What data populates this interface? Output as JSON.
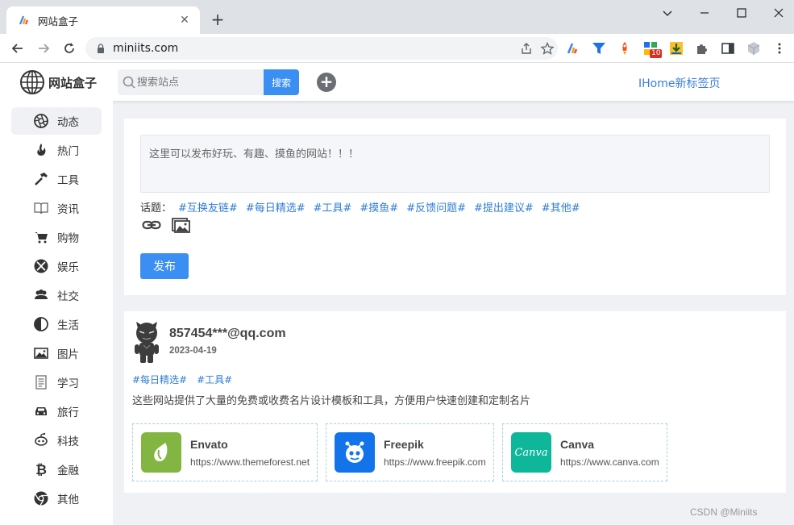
{
  "browser": {
    "tab_title": "网站盒子",
    "url": "miniits.com",
    "extension_badge": "10"
  },
  "site": {
    "logo_text": "网站盒子",
    "search_placeholder": "搜索站点",
    "search_button": "搜索",
    "add_button": "+",
    "ihome_link": "IHome新标签页"
  },
  "sidebar": {
    "items": [
      {
        "label": "动态",
        "icon": "aperture-icon"
      },
      {
        "label": "热门",
        "icon": "fire-icon"
      },
      {
        "label": "工具",
        "icon": "hammer-icon"
      },
      {
        "label": "资讯",
        "icon": "book-icon"
      },
      {
        "label": "购物",
        "icon": "cart-icon"
      },
      {
        "label": "娱乐",
        "icon": "xbox-icon"
      },
      {
        "label": "社交",
        "icon": "users-icon"
      },
      {
        "label": "生活",
        "icon": "half-circle-icon"
      },
      {
        "label": "图片",
        "icon": "image-icon"
      },
      {
        "label": "学习",
        "icon": "document-icon"
      },
      {
        "label": "旅行",
        "icon": "car-icon"
      },
      {
        "label": "科技",
        "icon": "robot-icon"
      },
      {
        "label": "金融",
        "icon": "bitcoin-icon"
      },
      {
        "label": "其他",
        "icon": "chrome-icon"
      }
    ]
  },
  "composer": {
    "placeholder": "这里可以发布好玩、有趣、摸鱼的网站！！！",
    "topics_label": "话题：",
    "topics": [
      "#互换友链#",
      "#每日精选#",
      "#工具#",
      "#摸鱼#",
      "#反馈问题#",
      "#提出建议#",
      "#其他#"
    ],
    "publish_button": "发布"
  },
  "post": {
    "user": "857454***@qq.com",
    "date": "2023-04-19",
    "tags": [
      "#每日精选#",
      "#工具#"
    ],
    "text": "这些网站提供了大量的免费或收费名片设计模板和工具，方便用户快速创建和定制名片",
    "sites": [
      {
        "name": "Envato",
        "url": "https://www.themeforest.net",
        "color": "#82b541"
      },
      {
        "name": "Freepik",
        "url": "https://www.freepik.com",
        "color": "#1273eb"
      },
      {
        "name": "Canva",
        "url": "https://www.canva.com",
        "color": "#0fb79a",
        "logo_text": "Canva"
      }
    ]
  },
  "watermark": "CSDN @Miniits",
  "colors": {
    "accent": "#3b8ff2",
    "link": "#2f7dd6",
    "page_bg": "#f0f1f4"
  }
}
